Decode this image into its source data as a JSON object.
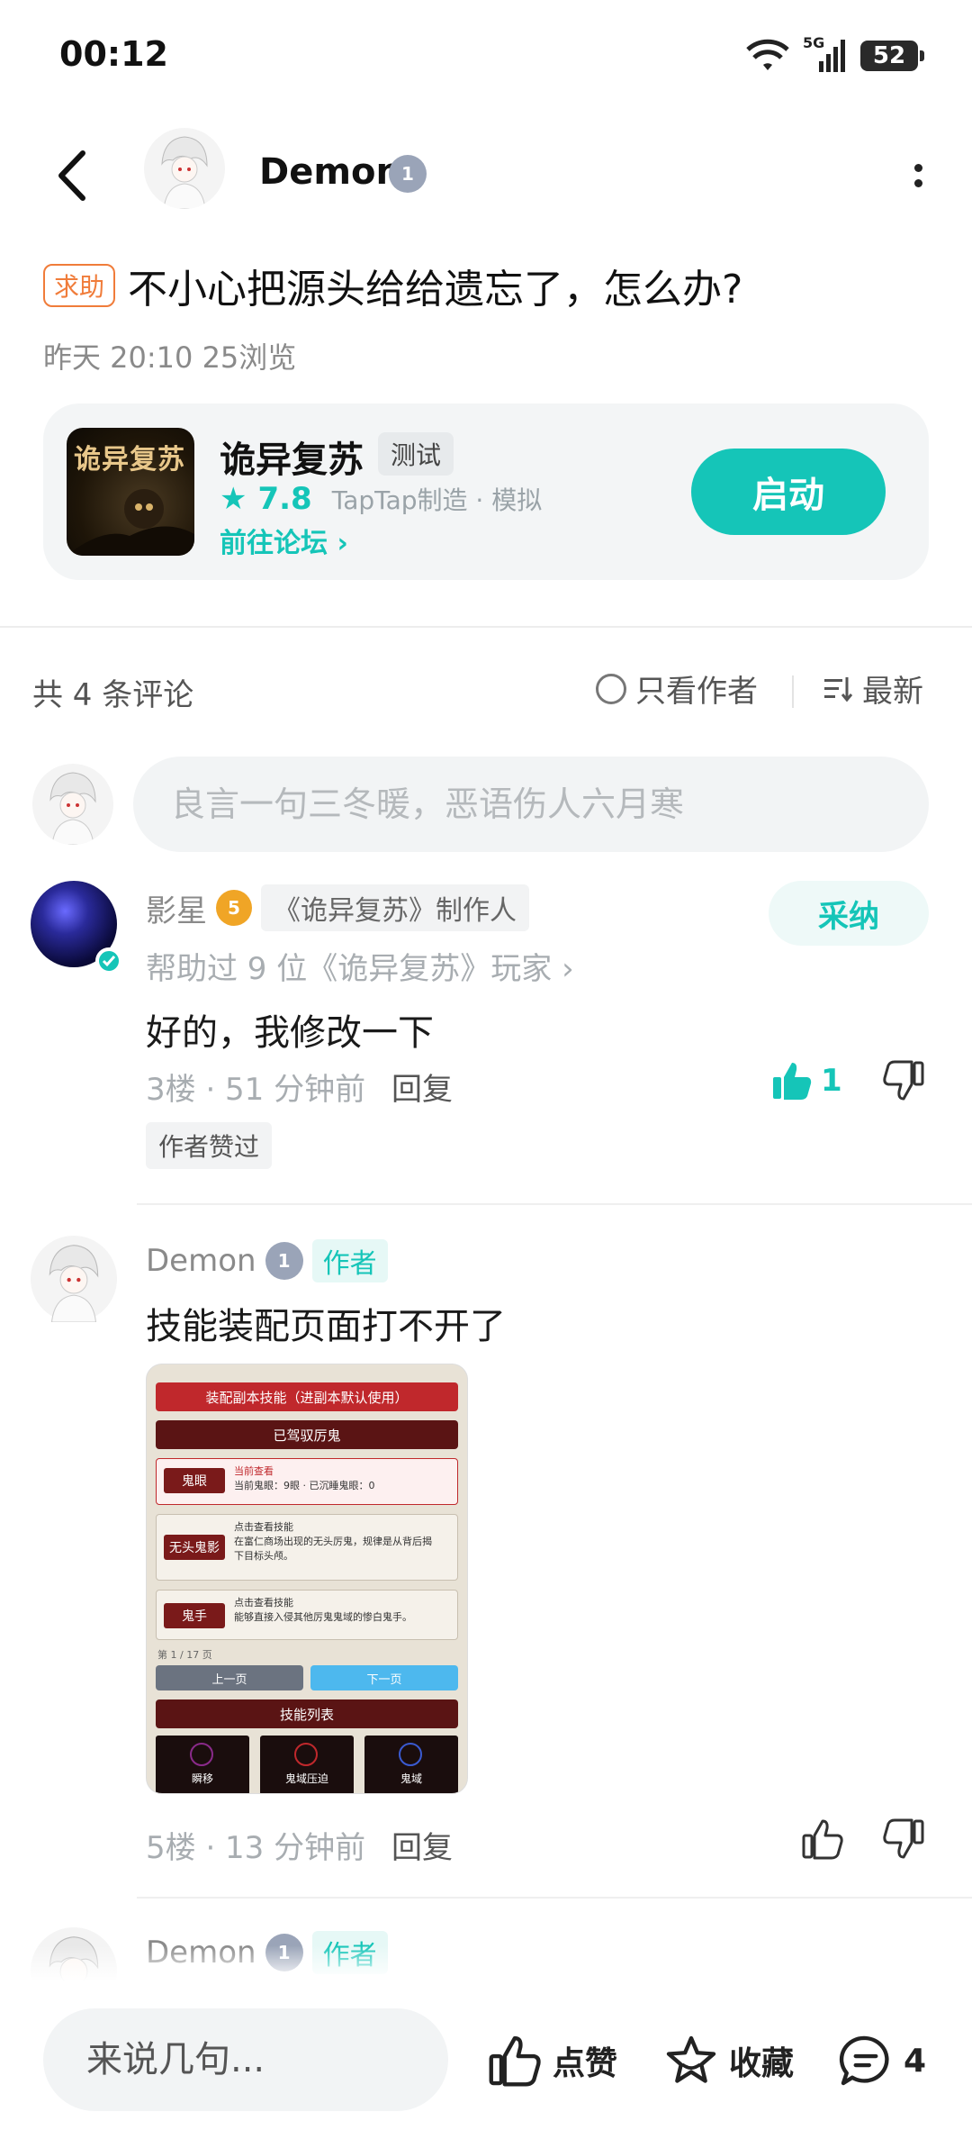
{
  "status": {
    "time": "00:12",
    "network": "5G",
    "battery": "52"
  },
  "header": {
    "author": "Demon",
    "level": "1"
  },
  "post": {
    "tag": "求助",
    "title": "不小心把源头给给遗忘了，怎么办?",
    "meta": "昨天 20:10  25浏览"
  },
  "game": {
    "icon_text": "诡异复苏",
    "name": "诡异复苏",
    "tag": "测试",
    "rating": "7.8",
    "sub": "TapTap制造 · 模拟",
    "forum_link": "前往论坛",
    "launch": "启动"
  },
  "comments_bar": {
    "count": "共 4 条评论",
    "only_author": "只看作者",
    "sort": "最新"
  },
  "comment_input": {
    "placeholder": "良言一句三冬暖，恶语伤人六月寒"
  },
  "comments": [
    {
      "name": "影星",
      "badge": "5",
      "maker_tag": "《诡异复苏》制作人",
      "adopt": "采纳",
      "helped": "帮助过 9 位《诡异复苏》玩家",
      "text": "好的，我修改一下",
      "floor_time": "3楼 · 51 分钟前",
      "reply": "回复",
      "likes": "1",
      "liked_tag": "作者赞过"
    },
    {
      "name": "Demon",
      "level": "1",
      "author_tag": "作者",
      "text": "技能装配页面打不开了",
      "floor_time": "5楼 · 13 分钟前",
      "reply": "回复",
      "image": {
        "bar1": "装配副本技能（进副本默认使用）",
        "bar2": "已驾驭厉鬼",
        "card1_chip": "鬼眼",
        "card1_l1": "当前查看",
        "card1_l2": "当前鬼眼：9眼 · 已沉睡鬼眼：0",
        "card2_chip": "无头鬼影",
        "card2_l1": "点击查看技能",
        "card2_l2": "在富仁商场出现的无头厉鬼，规律是从背后揭",
        "card2_l3": "下目标头颅。",
        "card3_chip": "鬼手",
        "card3_l1": "点击查看技能",
        "card3_l2": "能够直接入侵其他厉鬼鬼域的惨白鬼手。",
        "page": "第 1 / 17 页",
        "prev": "上一页",
        "next": "下一页",
        "list_title": "技能列表",
        "skill1": "瞬移",
        "skill2": "鬼域压迫",
        "skill3": "鬼域"
      }
    },
    {
      "name": "Demon",
      "level": "1",
      "author_tag": "作者"
    }
  ],
  "bottom_bar": {
    "placeholder": "来说几句...",
    "like": "点赞",
    "favorite": "收藏",
    "comments": "4"
  },
  "colors": {
    "accent": "#15c5b8",
    "help_tag": "#f07c3a"
  }
}
